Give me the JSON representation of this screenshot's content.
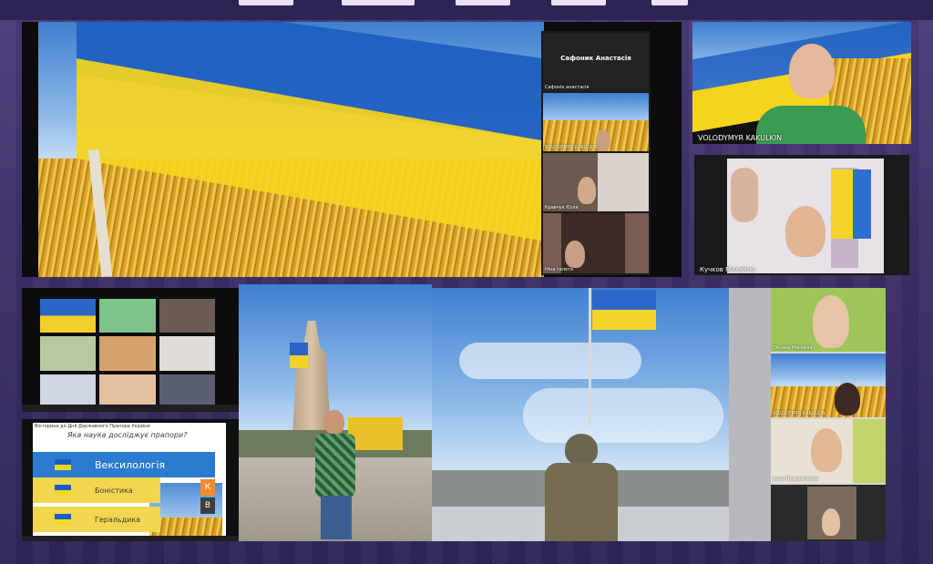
{
  "colors": {
    "ua_blue": "#1f5fc0",
    "ua_yellow": "#f5d41e",
    "frame": "#3b2f63"
  },
  "panel1_zoom": {
    "speaker_name_big": "Сафоник Анастасія",
    "tiles": [
      {
        "label": "Сафонік анастасія"
      },
      {
        "label": "VOLODYMYR KAKULKIN"
      },
      {
        "label": "Кравчук Юлія"
      },
      {
        "label": "Ніна гелета"
      }
    ]
  },
  "panel_volodymyr": {
    "label": "VOLODYMYR KAKULKIN"
  },
  "panel_kuchkov": {
    "label": "Кучков Михайло"
  },
  "slide": {
    "header_line": "Вікторина до Дня Державного Прапора України",
    "question": "Яка наука досліджує прапори?",
    "options": [
      "Вексилологія",
      "Боністика",
      "Геральдика"
    ],
    "side_letters": [
      "К",
      "В"
    ]
  },
  "panel_right_zoom": {
    "tiles": [
      {
        "label": "Оксана Мамаєва"
      },
      {
        "label": "VOLODYMYR KAKULKIN"
      },
      {
        "label": "Анна Прохватілова"
      },
      {
        "label": ""
      }
    ]
  }
}
